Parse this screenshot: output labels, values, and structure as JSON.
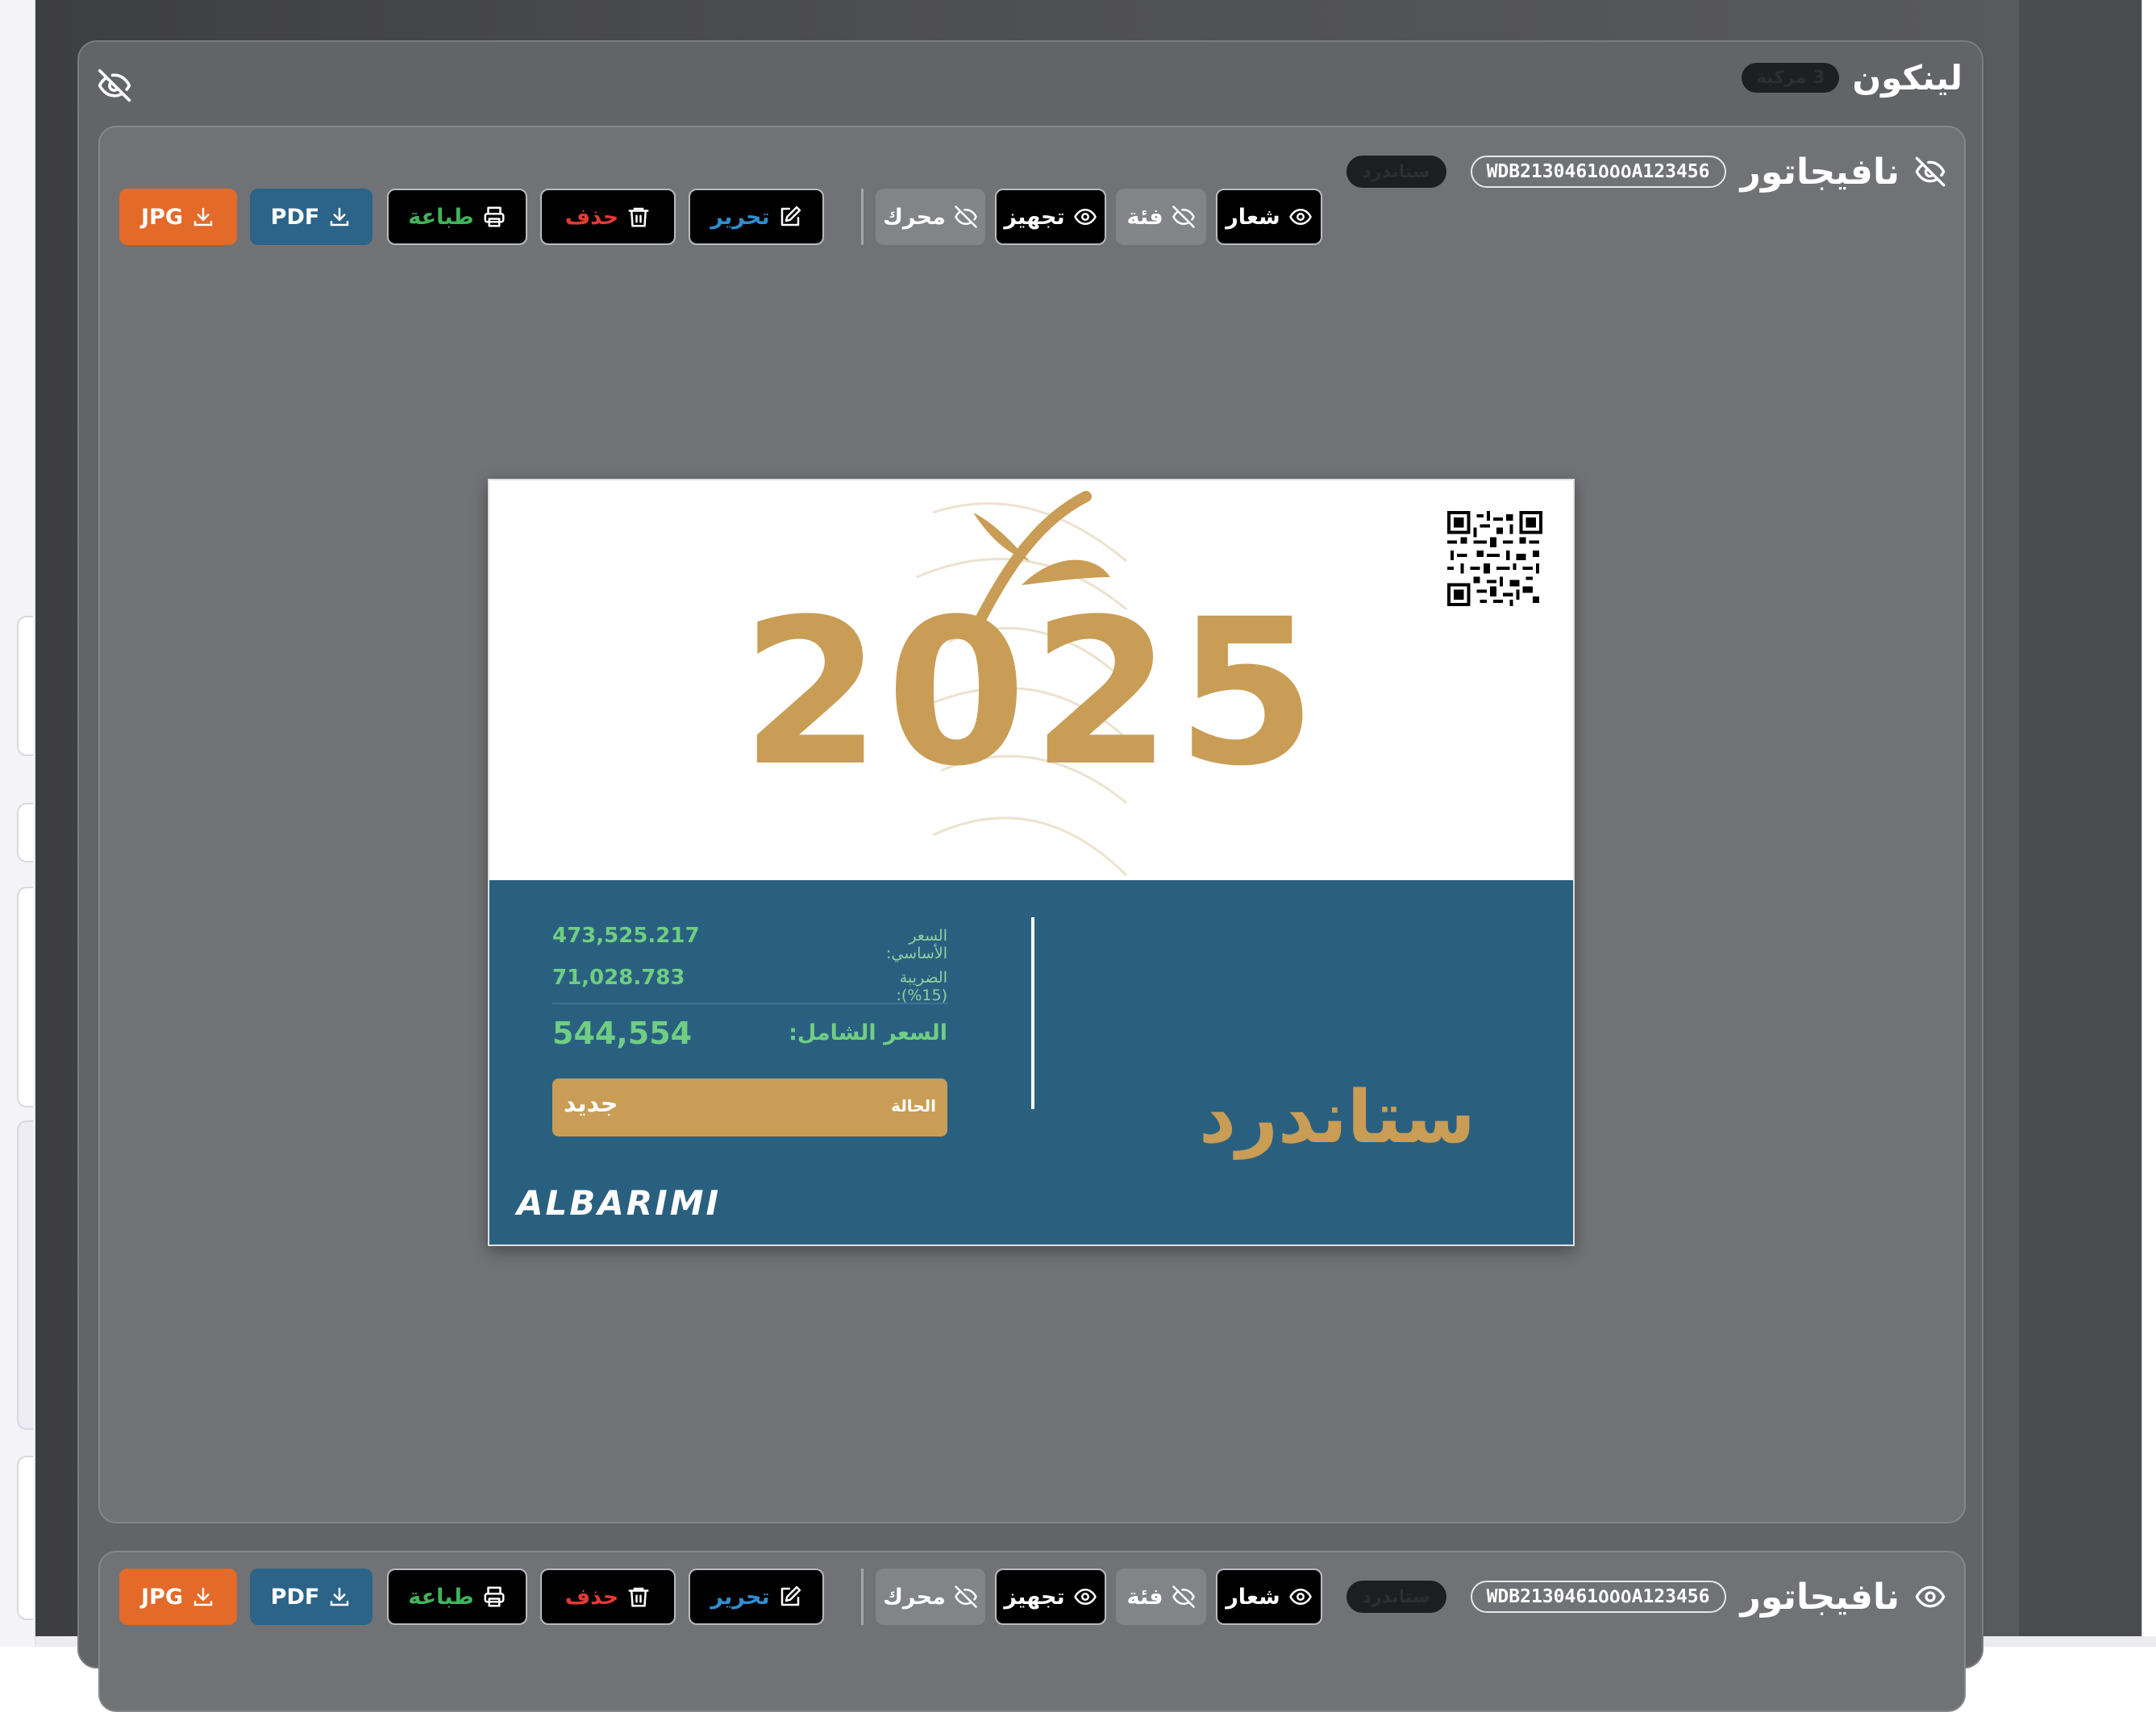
{
  "group": {
    "title": "لينكون",
    "count": "3 مركبة"
  },
  "cards": [
    {
      "model": "نافيجاتور",
      "vin": "WDB2130461٥٥٥A123456",
      "trim_badge": "ستاندرد",
      "toggles": {
        "logo": "شعار",
        "category": "فئة",
        "equipment": "تجهيز",
        "engine": "محرك"
      },
      "actions": {
        "edit": "تحرير",
        "delete": "حذف",
        "print": "طباعة",
        "pdf": "PDF",
        "jpg": "JPG"
      }
    },
    {
      "model": "نافيجاتور",
      "vin": "WDB2130461٥٥٥A123456",
      "trim_badge": "ستاندرد",
      "toggles": {
        "logo": "شعار",
        "category": "فئة",
        "equipment": "تجهيز",
        "engine": "محرك"
      },
      "actions": {
        "edit": "تحرير",
        "delete": "حذف",
        "print": "طباعة",
        "pdf": "PDF",
        "jpg": "JPG"
      }
    }
  ],
  "sticker": {
    "year": "2025",
    "base_price_label": "السعر الأساسي:",
    "base_price": "473,525.217",
    "tax_label": "الضريبة (15%):",
    "tax": "71,028.783",
    "total_label": "السعر الشامل:",
    "total": "544,554",
    "status_label": "الحالة",
    "status": "جديد",
    "trim": "ستاندرد",
    "brand": "ALBARIMI"
  },
  "colors": {
    "accent_gold": "#c99d55",
    "sticker_blue": "#2a607f",
    "pdf_button": "#2b6488",
    "jpg_button": "#e36a29"
  }
}
